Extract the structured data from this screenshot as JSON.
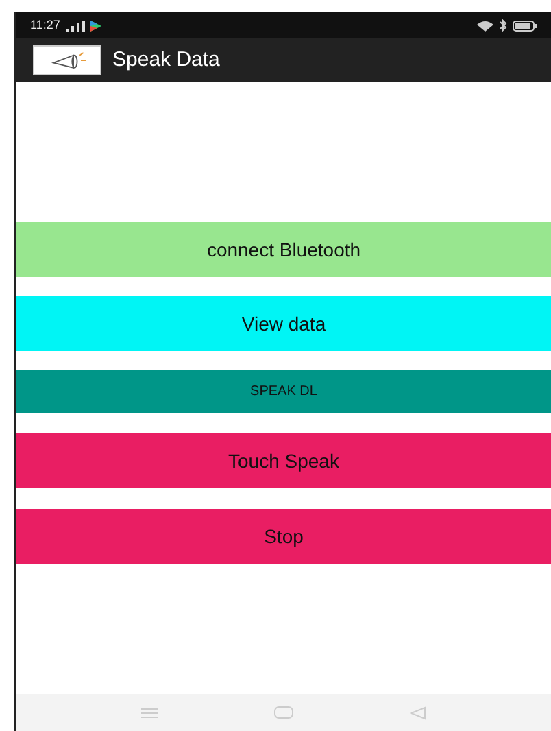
{
  "status_bar": {
    "time": "11:27"
  },
  "app_bar": {
    "title": "Speak Data"
  },
  "buttons": [
    {
      "label": "connect Bluetooth",
      "color": "#98e68f",
      "kind": "regular"
    },
    {
      "label": "View data",
      "color": "#00f5f5",
      "kind": "regular"
    },
    {
      "label": "SPEAK DL",
      "color": "#009688",
      "kind": "compact"
    },
    {
      "label": "Touch Speak",
      "color": "#e91e63",
      "kind": "regular"
    },
    {
      "label": "Stop",
      "color": "#e91e63",
      "kind": "regular"
    }
  ]
}
